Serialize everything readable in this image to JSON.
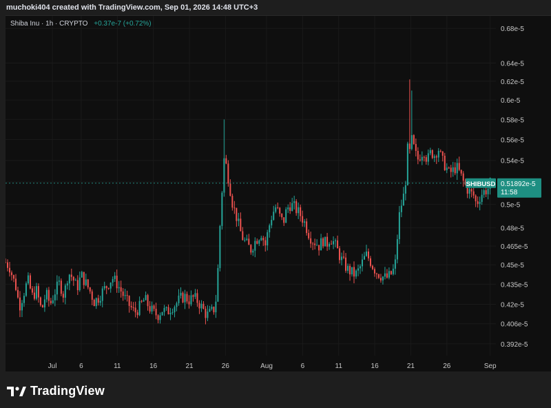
{
  "header": {
    "author_line": "muchoki404 created with TradingView.com, Sep 01, 2026 14:48 UTC+3"
  },
  "legend": {
    "symbol_line": "Shiba Inu · 1h · CRYPTO",
    "change": "+0.37e-7 (+0.72%)"
  },
  "badge": {
    "ticker": "SHIBUSD",
    "price": "0.51892e-5",
    "countdown": "11:58"
  },
  "footer": {
    "brand": "TradingView"
  },
  "chart_data": {
    "type": "candlestick",
    "y_scale": "log",
    "ylim": [
      0.384,
      0.695
    ],
    "y_unit": "e-5",
    "y_ticks": [
      0.392,
      0.406,
      0.42,
      0.435,
      0.45,
      0.465,
      0.48,
      0.5,
      0.52,
      0.54,
      0.56,
      0.58,
      0.6,
      0.62,
      0.64,
      0.68
    ],
    "y_tick_labels": [
      "0.392e-5",
      "0.406e-5",
      "0.42e-5",
      "0.435e-5",
      "0.45e-5",
      "0.465e-5",
      "0.48e-5",
      "0.5e-5",
      "0.52e-5",
      "0.54e-5",
      "0.56e-5",
      "0.58e-5",
      "0.6e-5",
      "0.62e-5",
      "0.64e-5",
      "0.68e-5"
    ],
    "x_ticks": [
      {
        "day": 2,
        "label": "Jul"
      },
      {
        "day": 6,
        "label": "6"
      },
      {
        "day": 11,
        "label": "11"
      },
      {
        "day": 16,
        "label": "16"
      },
      {
        "day": 21,
        "label": "21"
      },
      {
        "day": 26,
        "label": "26"
      },
      {
        "day": 31.7,
        "label": "Aug"
      },
      {
        "day": 36.7,
        "label": "6"
      },
      {
        "day": 41.7,
        "label": "11"
      },
      {
        "day": 46.7,
        "label": "16"
      },
      {
        "day": 51.7,
        "label": "21"
      },
      {
        "day": 56.7,
        "label": "26"
      },
      {
        "day": 62.7,
        "label": "Sep"
      }
    ],
    "xlim_days": [
      -4.5,
      63.5
    ],
    "price_path": [
      [
        -4.5,
        0.452
      ],
      [
        -3.9,
        0.448
      ],
      [
        -3.5,
        0.44
      ],
      [
        -3.0,
        0.432
      ],
      [
        -2.6,
        0.418
      ],
      [
        -2.0,
        0.428
      ],
      [
        -1.4,
        0.438
      ],
      [
        -0.8,
        0.426
      ],
      [
        -0.2,
        0.43
      ],
      [
        0.5,
        0.415
      ],
      [
        1.1,
        0.428
      ],
      [
        1.7,
        0.42
      ],
      [
        2.4,
        0.43
      ],
      [
        3.0,
        0.436
      ],
      [
        3.6,
        0.426
      ],
      [
        4.2,
        0.444
      ],
      [
        4.8,
        0.44
      ],
      [
        5.4,
        0.432
      ],
      [
        6.0,
        0.442
      ],
      [
        6.6,
        0.436
      ],
      [
        7.2,
        0.43
      ],
      [
        7.8,
        0.422
      ],
      [
        8.4,
        0.425
      ],
      [
        9.0,
        0.43
      ],
      [
        9.6,
        0.434
      ],
      [
        10.3,
        0.44
      ],
      [
        10.9,
        0.436
      ],
      [
        11.5,
        0.43
      ],
      [
        12.1,
        0.424
      ],
      [
        12.7,
        0.419
      ],
      [
        13.4,
        0.414
      ],
      [
        14.1,
        0.418
      ],
      [
        14.8,
        0.424
      ],
      [
        15.4,
        0.418
      ],
      [
        16.0,
        0.414
      ],
      [
        16.6,
        0.412
      ],
      [
        17.2,
        0.416
      ],
      [
        17.9,
        0.414
      ],
      [
        18.5,
        0.418
      ],
      [
        19.1,
        0.42
      ],
      [
        19.7,
        0.424
      ],
      [
        20.3,
        0.426
      ],
      [
        20.9,
        0.423
      ],
      [
        21.6,
        0.425
      ],
      [
        22.2,
        0.422
      ],
      [
        22.8,
        0.417
      ],
      [
        23.4,
        0.412
      ],
      [
        24.0,
        0.414
      ],
      [
        24.6,
        0.418
      ],
      [
        25.0,
        0.45
      ],
      [
        25.3,
        0.49
      ],
      [
        25.6,
        0.52
      ],
      [
        25.85,
        0.545
      ],
      [
        26.1,
        0.535
      ],
      [
        26.5,
        0.52
      ],
      [
        27.0,
        0.5
      ],
      [
        27.5,
        0.49
      ],
      [
        28.0,
        0.478
      ],
      [
        28.5,
        0.47
      ],
      [
        29.0,
        0.466
      ],
      [
        29.5,
        0.462
      ],
      [
        30.0,
        0.468
      ],
      [
        30.5,
        0.472
      ],
      [
        31.0,
        0.476
      ],
      [
        31.5,
        0.465
      ],
      [
        32.0,
        0.48
      ],
      [
        32.5,
        0.492
      ],
      [
        33.0,
        0.498
      ],
      [
        33.5,
        0.49
      ],
      [
        34.0,
        0.484
      ],
      [
        34.5,
        0.496
      ],
      [
        35.0,
        0.5
      ],
      [
        35.5,
        0.498
      ],
      [
        36.0,
        0.494
      ],
      [
        36.5,
        0.49
      ],
      [
        37.0,
        0.484
      ],
      [
        37.5,
        0.476
      ],
      [
        38.0,
        0.47
      ],
      [
        38.5,
        0.468
      ],
      [
        39.0,
        0.465
      ],
      [
        39.5,
        0.47
      ],
      [
        40.0,
        0.466
      ],
      [
        40.5,
        0.472
      ],
      [
        41.0,
        0.468
      ],
      [
        41.5,
        0.462
      ],
      [
        42.0,
        0.455
      ],
      [
        42.5,
        0.45
      ],
      [
        43.0,
        0.446
      ],
      [
        43.5,
        0.444
      ],
      [
        44.0,
        0.442
      ],
      [
        44.5,
        0.446
      ],
      [
        45.0,
        0.452
      ],
      [
        45.5,
        0.458
      ],
      [
        46.0,
        0.454
      ],
      [
        46.5,
        0.448
      ],
      [
        47.0,
        0.444
      ],
      [
        47.5,
        0.442
      ],
      [
        48.0,
        0.44
      ],
      [
        48.5,
        0.44
      ],
      [
        49.0,
        0.443
      ],
      [
        49.5,
        0.448
      ],
      [
        49.8,
        0.47
      ],
      [
        50.1,
        0.49
      ],
      [
        50.4,
        0.5
      ],
      [
        50.8,
        0.51
      ],
      [
        51.1,
        0.53
      ],
      [
        51.3,
        0.555
      ],
      [
        51.5,
        0.545
      ],
      [
        51.8,
        0.56
      ],
      [
        52.2,
        0.55
      ],
      [
        52.6,
        0.54
      ],
      [
        53.0,
        0.545
      ],
      [
        53.5,
        0.55
      ],
      [
        54.0,
        0.54
      ],
      [
        54.5,
        0.548
      ],
      [
        55.0,
        0.545
      ],
      [
        55.5,
        0.552
      ],
      [
        56.0,
        0.54
      ],
      [
        56.5,
        0.535
      ],
      [
        57.0,
        0.528
      ],
      [
        57.5,
        0.53
      ],
      [
        58.0,
        0.534
      ],
      [
        58.5,
        0.528
      ],
      [
        59.0,
        0.52
      ],
      [
        59.5,
        0.514
      ],
      [
        60.0,
        0.51
      ],
      [
        60.4,
        0.508
      ],
      [
        60.8,
        0.5
      ],
      [
        61.2,
        0.506
      ],
      [
        61.6,
        0.51
      ],
      [
        62.0,
        0.512
      ],
      [
        62.4,
        0.514
      ],
      [
        62.7,
        0.51892
      ]
    ],
    "spikes": [
      {
        "day": 25.9,
        "high": 0.58
      },
      {
        "day": 51.6,
        "high": 0.622
      },
      {
        "day": 51.75,
        "high": 0.61
      }
    ],
    "last_price": 0.51892
  },
  "colors": {
    "background": "#0f0f0f",
    "up": "#26a69a",
    "down": "#ef5350",
    "grid": "#1a1a1a",
    "axis_text": "#c8c8c8",
    "badge_bg": "#1e8f82"
  }
}
